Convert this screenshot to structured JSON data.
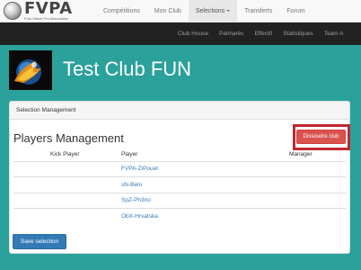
{
  "brand": {
    "title": "FVPA",
    "subtitle": "Futo Virtual Pro Association"
  },
  "topnav": {
    "items": [
      {
        "label": "Compétitions"
      },
      {
        "label": "Mon Club"
      },
      {
        "label": "Selections"
      },
      {
        "label": "Transferts"
      },
      {
        "label": "Forum"
      }
    ],
    "active": "Selections"
  },
  "subnav": {
    "items": [
      {
        "label": "Club House"
      },
      {
        "label": "Palmarès"
      },
      {
        "label": "Effectif"
      },
      {
        "label": "Statistiques"
      },
      {
        "label": "Team A"
      }
    ]
  },
  "club": {
    "name": "Test Club FUN"
  },
  "panel": {
    "heading": "Selection Management",
    "section_title": "Players Management",
    "dissolve_label": "Dissoudre club",
    "save_label": "Save selection",
    "columns": {
      "kick": "Kick Player",
      "player": "Player",
      "manager": "Manager"
    },
    "players": [
      {
        "name": "FVPA-ZiPouet"
      },
      {
        "name": "sN-Belo"
      },
      {
        "name": "SpZ-Ph3no"
      },
      {
        "name": "ObX-Hrvatska"
      }
    ]
  },
  "colors": {
    "background": "#2ba19b",
    "dissolve_button": "#d9534f",
    "highlight_frame": "#c0272d",
    "save_button": "#337ab7"
  }
}
